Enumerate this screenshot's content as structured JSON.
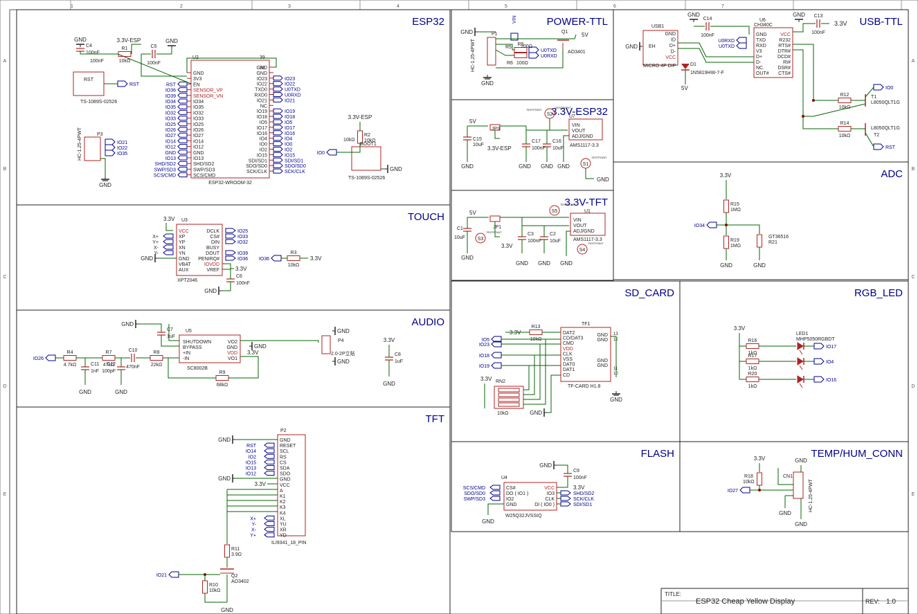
{
  "sheet": {
    "col_numbers": [
      "1",
      "2",
      "3",
      "4",
      "5",
      "6",
      "7"
    ],
    "row_letters": [
      "A",
      "B",
      "C",
      "D",
      "E"
    ],
    "title_label": "TITLE:",
    "title": "ESP32 Cheap Yellow Display",
    "rev_label": "REV:",
    "rev": "1.0"
  },
  "sections": {
    "esp32": "ESP32",
    "power_ttl": "POWER-TTL",
    "usb_ttl": "USB-TTL",
    "reg_esp32": "3.3V-ESP32",
    "reg_tft": "3.3V-TFT",
    "adc": "ADC",
    "touch": "TOUCH",
    "audio": "AUDIO",
    "sd_card": "SD_CARD",
    "rgb_led": "RGB_LED",
    "tft": "TFT",
    "flash": "FLASH",
    "temp_hum": "TEMP/HUM_CONN"
  },
  "esp32": {
    "ref": "U2",
    "part": "ESP32-WROOM-32",
    "left_pins": [
      "GND",
      "3V3",
      "EN",
      "SENSOR_VP",
      "SENSOR_VN",
      "IO34",
      "IO35",
      "IO32",
      "IO33",
      "IO25",
      "IO26",
      "IO27",
      "IO14",
      "IO12",
      "GND",
      "IO13",
      "SHD/SD2",
      "SWP/SD3",
      "SCS/CMD"
    ],
    "left_nets": [
      "",
      "",
      "RST",
      "IO36",
      "IO39",
      "IO34",
      "IO35",
      "IO32",
      "IO33",
      "IO25",
      "IO26",
      "IO27",
      "IO14",
      "IO12",
      "GND",
      "IO13",
      "SHD/SD2",
      "SWP/SD3",
      "SCS/CMD"
    ],
    "right_pins": [
      "GND",
      "GND",
      "IO23",
      "IO22",
      "TXD0",
      "RXD0",
      "IO21",
      "NC",
      "IO19",
      "IO18",
      "IO5",
      "IO17",
      "IO16",
      "IO4",
      "IO0",
      "IO2",
      "IO15",
      "SDI/SD1",
      "SDO/SD0",
      "SCK/CLK"
    ],
    "right_nets": [
      "",
      "",
      "IO23",
      "IO22",
      "U0TXD",
      "U0RXD",
      "IO21",
      "",
      "IO19",
      "IO18",
      "IO5",
      "IO17",
      "IO16",
      "IO4",
      "IO0",
      "IO2",
      "IO15",
      "SDI/SD1",
      "SDO/SD0",
      "SCK/CLK"
    ],
    "pin39": "39",
    "pin38": "38",
    "c4": "C4",
    "c4_val": "100nF",
    "r1": "R1",
    "r1_val": "10kΩ",
    "c5": "C5",
    "c5_val": "100nF",
    "net_33_esp": "3.3V-ESP",
    "gnd": "GND",
    "rst_sw": "RST",
    "rst_sw_part": "TS-1089S-02526",
    "rst_net": "RST",
    "p3": "P3",
    "p3_part": "HC-1.25-4PWT",
    "p3_nets": [
      "IO21",
      "IO22",
      "IO35"
    ],
    "boot_net": "3.3V-ESP",
    "r2": "R2",
    "r2_val": "10kΩ",
    "boot": "BOOT1",
    "boot_part": "TS-1089S-02526",
    "io0": "IO0"
  },
  "power_ttl": {
    "p1": "P1",
    "p1_part": "HC-1.25-4PWT",
    "vin": "VIN",
    "r5": "R5",
    "r5_val": "100Ω",
    "r6": "R6",
    "r6_val": "100Ω",
    "u0txd": "U0TXD",
    "u0rxd": "U0RXD",
    "q1": "Q1",
    "q1_part": "AO3401",
    "v5": "5V",
    "gnd": "GND"
  },
  "usb_ttl": {
    "usb1": "USB1",
    "usb_part": "MICRO 4P DIP",
    "usb_pins": [
      "GND",
      "ID",
      "D+",
      "D-",
      "VCC"
    ],
    "eh": "EH",
    "d1": "D1",
    "d1_part": "1N5819HW-7-F",
    "v5": "5V",
    "c14": "C14",
    "c14_val": "100nF",
    "u6": "U6",
    "u6_part": "CH340C",
    "u6_left": [
      "GND",
      "TXD",
      "RXD",
      "V3",
      "D+",
      "D-",
      "NC.",
      "OUT#"
    ],
    "u6_right": [
      "VCC",
      "R232",
      "RTS#",
      "DTR#",
      "DCD#",
      "RI#",
      "DSR#",
      "CTS#"
    ],
    "u0rxd": "U0RXD",
    "u0txd": "U0TXD",
    "c13": "C13",
    "c13_val": "100nF",
    "v33": "3.3V",
    "r12": "R12",
    "r12_val": "10kΩ",
    "r14": "R14",
    "r14_val": "10kΩ",
    "t1": "T1",
    "t1_part": "L8050QLT1G",
    "t2": "T2",
    "t2_part": "L8050QLT1G",
    "io0": "IO0",
    "rst": "RST",
    "gnd": "GND"
  },
  "reg_esp32": {
    "v5": "5V",
    "jp3": "JP3",
    "c15": "C15",
    "c15_val": "10uF",
    "c17": "C17",
    "c17_val": "100nF",
    "c16": "C16",
    "c16_val": "10uF",
    "s2": "S2",
    "s1": "S1",
    "testpoint": "TESTPOINT",
    "u7": "U7",
    "u7_part": "AMS1117-3.3",
    "pins": [
      "VIN",
      "VOUT",
      "ADJ/GND"
    ],
    "net": "3.3V-ESP",
    "gnd": "GND"
  },
  "reg_tft": {
    "v5": "5V",
    "c1": "C1",
    "c1_val": "10uF",
    "jp1": "JP1",
    "s3": "S3",
    "s5": "S5",
    "s4": "S4",
    "testpoint": "TESTPOINT",
    "c3": "C3",
    "c3_val": "100nF",
    "c2": "C2",
    "c2_val": "10uF",
    "u1": "U1",
    "u1_part": "AMS1117-3.3",
    "pins": [
      "VIN",
      "VOUT",
      "ADJ/GND"
    ],
    "v33": "3.3V",
    "gnd": "GND"
  },
  "adc": {
    "v33": "3.3V",
    "r15": "R15",
    "r15_val": "1MΩ",
    "r19": "R19",
    "r19_val": "1MΩ",
    "io34": "IO34",
    "ldr": "GT36516",
    "r21": "R21",
    "gnd": "GND"
  },
  "touch": {
    "v33": "3.3V",
    "u3": "U3",
    "part": "XPT2046",
    "left_pins": [
      "VCC",
      "XP",
      "YP",
      "XN",
      "YN",
      "GND",
      "VBAT",
      "AUX"
    ],
    "left_nets": [
      "X+",
      "Y+",
      "X-",
      "Y-"
    ],
    "right_pins": [
      "DCLK",
      "CS#",
      "DIN",
      "BUSY",
      "DOUT",
      "PENIRQ#",
      "IOVDD",
      "VREF"
    ],
    "right_nets": [
      "IO25",
      "IO33",
      "IO32",
      "IO39",
      "IO36"
    ],
    "r3": "R3",
    "r3_val": "10kΩ",
    "io36": "IO36",
    "c6": "C6",
    "c6_val": "100nF",
    "gnd": "GND"
  },
  "audio": {
    "io26": "IO26",
    "r4": "R4",
    "r4_val": "4.7kΩ",
    "c11": "C11",
    "c11_val": "1nF",
    "r7": "R7",
    "r7_val": "47kΩ",
    "c12": "C12",
    "c12_val": "100pF",
    "c10": "C10",
    "c10_val": "470nF",
    "r8": "R8",
    "r8_val": "22kΩ",
    "c7": "C7",
    "c7_val": "1uF",
    "u5": "U5",
    "u5_part": "SC8002B",
    "left_pins": [
      "SHUTDOWN",
      "BYPASS",
      "+IN",
      "-IN"
    ],
    "right_pins": [
      "VO2",
      "GND",
      "VDD",
      "VO1"
    ],
    "r9": "R9",
    "r9_val": "68kΩ",
    "p4": "P4",
    "p4_part": "2.0-2P立贴",
    "v33": "3.3V",
    "c8": "C8",
    "c8_val": "1uF",
    "gnd": "GND"
  },
  "sd": {
    "tf1": "TF1",
    "part": "TF-CARD H1.8",
    "pins": [
      "DAT2",
      "CD/DAT3",
      "CMD",
      "VDD",
      "CLK",
      "VSS",
      "DAT0",
      "DAT1",
      "CD"
    ],
    "nets": [
      "IO5",
      "IO23",
      "IO18",
      "IO19"
    ],
    "r13": "R13",
    "r13_val": "10kΩ",
    "rn2": "RN2",
    "rn2_val": "10kΩ",
    "v33": "3.3V",
    "gnd": "GND",
    "gnd_pins": [
      "13",
      "12",
      "11",
      "10"
    ]
  },
  "rgb": {
    "v33": "3.3V",
    "led1": "LED1",
    "part": "MHP5050RGBDT",
    "r16": "R16",
    "r17": "R17",
    "r20": "R20",
    "r_val": "1kΩ",
    "nets": [
      "IO17",
      "IO4",
      "IO16"
    ]
  },
  "tft": {
    "p2": "P2",
    "part": "ILI9341_18_PIN",
    "pins": [
      "GND",
      "RESET",
      "SCL",
      "RS",
      "CS",
      "SDA",
      "SDO",
      "GND",
      "VCC",
      "A",
      "K1",
      "K2",
      "K3",
      "K4",
      "XL",
      "YU",
      "XR",
      "YD"
    ],
    "nets": [
      "",
      "RST",
      "IO14",
      "IO2",
      "IO15",
      "IO13",
      "IO12",
      "",
      "3.3V",
      "",
      "",
      "",
      "",
      "",
      "X+",
      "Y-",
      "X-",
      "Y+"
    ],
    "r11": "R11",
    "r11_val": "3.9Ω",
    "r10": "R10",
    "r10_val": "10kΩ",
    "q2": "Q2",
    "q2_part": "AO3402",
    "io21": "IO21",
    "gnd": "GND"
  },
  "flash": {
    "u4": "U4",
    "part": "W25Q32JVSSIQ",
    "left_pins": [
      "CS#",
      "DO ( IO1 )",
      "IO2",
      "GND"
    ],
    "left_nets": [
      "SCS/CMD",
      "SDO/SD0",
      "SWP/SD3"
    ],
    "right_pins": [
      "VCC",
      "IO3",
      "CLK",
      "DI ( IO0 )"
    ],
    "right_nets": [
      "SHD/SD2",
      "SCK/CLK",
      "SDI/SD1"
    ],
    "c9": "C9",
    "c9_val": "100nF",
    "v33": "3.3V",
    "gnd": "GND"
  },
  "temp": {
    "v33": "3.3V",
    "r18": "R18",
    "r18_val": "10kΩ",
    "io27": "IO27",
    "cn1": "CN1",
    "part": "HC-1.25-4PWT",
    "gnd": "GND"
  }
}
